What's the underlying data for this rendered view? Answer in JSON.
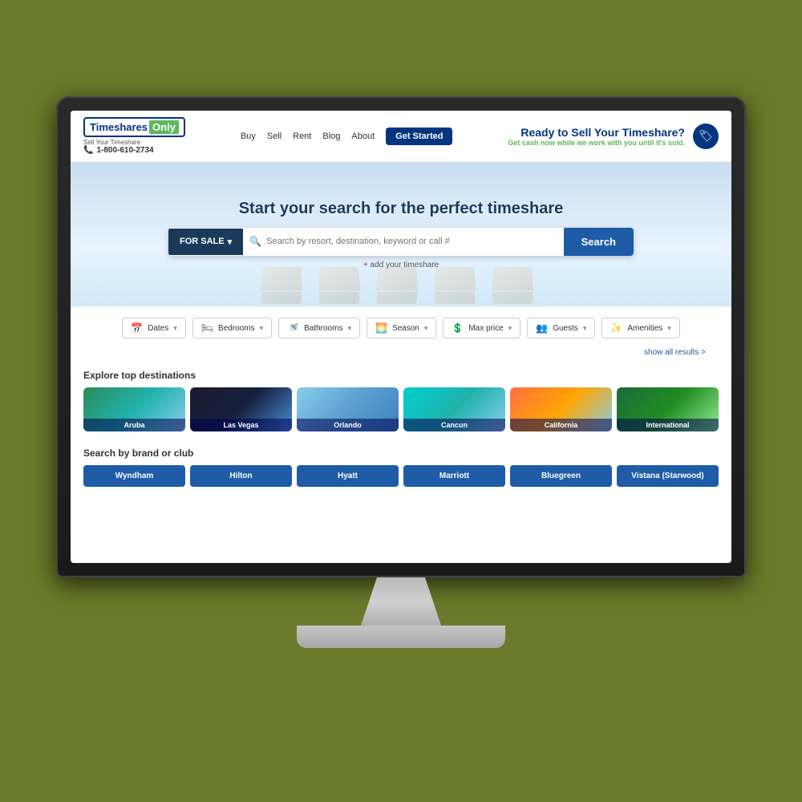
{
  "monitor": {
    "background_color": "#6b7a2a"
  },
  "header": {
    "logo": {
      "timeshares": "Timeshares",
      "only": "Only",
      "tagline": "Sell Your Timeshare",
      "phone": "1-800-610-2734"
    },
    "nav": {
      "buy": "Buy",
      "sell": "Sell",
      "rent": "Rent",
      "blog": "Blog",
      "about": "About",
      "get_started": "Get Started"
    },
    "promo": {
      "title": "Ready to Sell Your Timeshare?",
      "subtitle": "Get cash now",
      "subtitle_rest": " while we work with you until it's sold."
    }
  },
  "hero": {
    "title": "Start your search for the perfect timeshare",
    "for_sale_label": "FOR SALE",
    "search_placeholder": "Search by resort, destination, keyword or call #",
    "search_button": "Search",
    "add_link": "+ add your timeshare"
  },
  "filters": {
    "items": [
      {
        "icon": "📅",
        "label": "Dates"
      },
      {
        "icon": "🛏",
        "label": "Bedrooms"
      },
      {
        "icon": "🚿",
        "label": "Bathrooms"
      },
      {
        "icon": "🌅",
        "label": "Season"
      },
      {
        "icon": "💲",
        "label": "Max price"
      },
      {
        "icon": "👥",
        "label": "Guests"
      },
      {
        "icon": "✨",
        "label": "Amenities"
      }
    ],
    "show_all": "show all results >"
  },
  "destinations": {
    "section_title": "Explore top destinations",
    "items": [
      {
        "label": "Aruba",
        "class": "dest-aruba"
      },
      {
        "label": "Las Vegas",
        "class": "dest-vegas"
      },
      {
        "label": "Orlando",
        "class": "dest-orlando"
      },
      {
        "label": "Cancun",
        "class": "dest-cancun"
      },
      {
        "label": "California",
        "class": "dest-california"
      },
      {
        "label": "International",
        "class": "dest-international"
      }
    ]
  },
  "brands": {
    "section_title": "Search by brand or club",
    "items": [
      "Wyndham",
      "Hilton",
      "Hyatt",
      "Marriott",
      "Bluegreen",
      "Vistana (Starwood)"
    ]
  }
}
